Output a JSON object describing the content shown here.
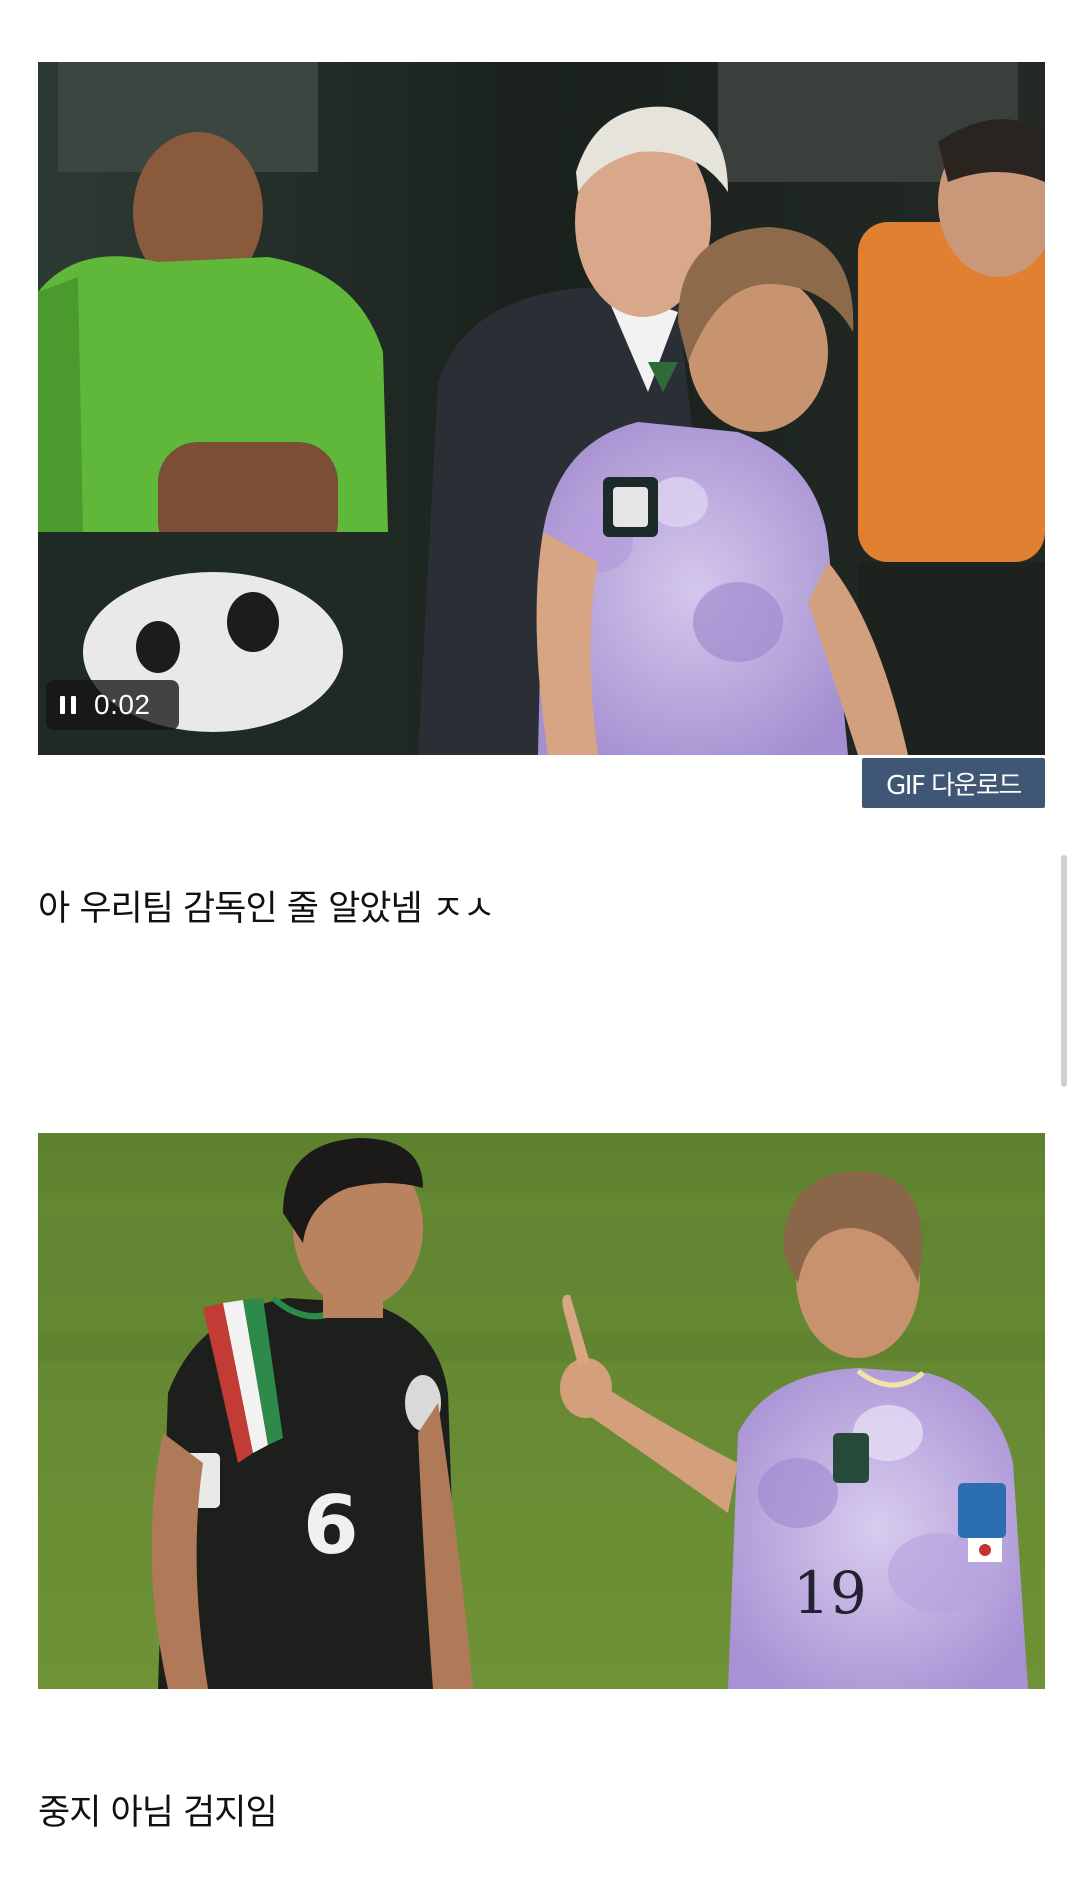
{
  "posts": [
    {
      "media_type": "gif",
      "media_description": "blurred soccer clip: a grey-haired coach in a dark suit beside a player in a lavender jersey, staff on the bench",
      "player": {
        "state": "playing",
        "time": "0:02"
      },
      "download_label": "GIF 다운로드",
      "caption": "아 우리팀 감독인 줄 알았넴 ㅈㅅ"
    },
    {
      "media_type": "image",
      "media_description": "two soccer players on a green pitch; the player in the lavender number 19 jersey raises an index finger toward the player in the black number 6 jersey",
      "jersey_numbers": [
        "6",
        "19"
      ],
      "caption": "중지 아님 검지임"
    }
  ],
  "colors": {
    "download_button_bg": "#3f5674",
    "video_control_bg": "#141414",
    "pitch_green": "#6a8a33",
    "lavender_jersey": "#c6b4e3",
    "scroll_indicator": "#d0d0d0"
  },
  "icons": {
    "video_control": "pause-icon"
  }
}
